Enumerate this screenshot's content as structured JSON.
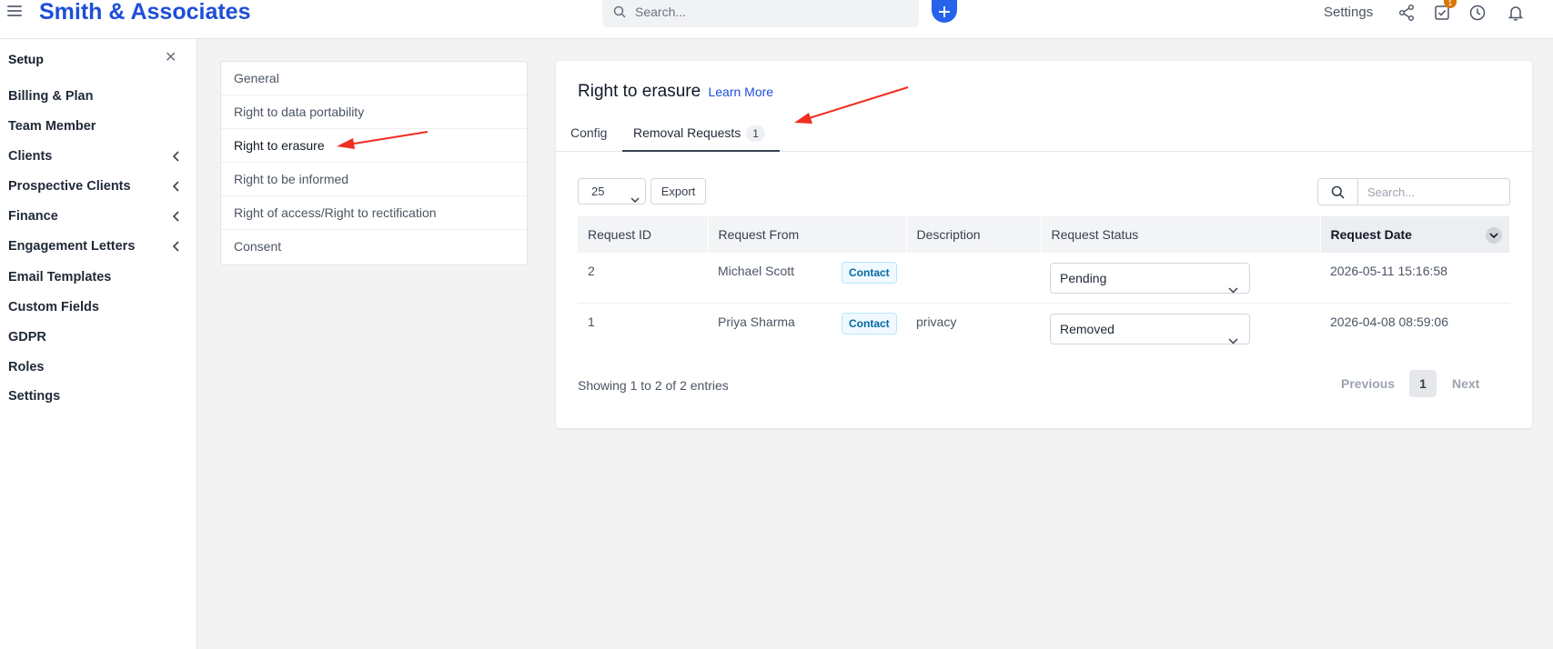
{
  "header": {
    "brand": "Smith & Associates",
    "search_placeholder": "Search...",
    "settings_label": "Settings",
    "notification_count": "1"
  },
  "sidebar": {
    "title": "Setup",
    "items": [
      {
        "label": "Billing & Plan",
        "expandable": false
      },
      {
        "label": "Team Member",
        "expandable": false
      },
      {
        "label": "Clients",
        "expandable": true
      },
      {
        "label": "Prospective Clients",
        "expandable": true
      },
      {
        "label": "Finance",
        "expandable": true
      },
      {
        "label": "Engagement Letters",
        "expandable": true
      },
      {
        "label": "Email Templates",
        "expandable": false
      },
      {
        "label": "Custom Fields",
        "expandable": false
      },
      {
        "label": "GDPR",
        "expandable": false
      },
      {
        "label": "Roles",
        "expandable": false
      },
      {
        "label": "Settings",
        "expandable": false
      }
    ]
  },
  "gdpr_nav": {
    "items": [
      "General",
      "Right to data portability",
      "Right to erasure",
      "Right to be informed",
      "Right of access/Right to rectification",
      "Consent"
    ],
    "active_index": 2
  },
  "main": {
    "title": "Right to erasure",
    "learn_more": "Learn More",
    "tabs": [
      {
        "label": "Config",
        "count": ""
      },
      {
        "label": "Removal Requests",
        "count": "1"
      }
    ],
    "active_tab": 1,
    "page_length": "25",
    "export_label": "Export",
    "table_search_placeholder": "Search...",
    "table": {
      "columns": [
        "Request ID",
        "Request From",
        "Description",
        "Request Status",
        "Request Date"
      ],
      "rows": [
        {
          "id": "2",
          "from": "Michael Scott",
          "type": "Contact",
          "description": "",
          "status": "Pending",
          "date": "2026-05-11 15:16:58"
        },
        {
          "id": "1",
          "from": "Priya Sharma",
          "type": "Contact",
          "description": "privacy",
          "status": "Removed",
          "date": "2026-04-08 08:59:06"
        }
      ]
    },
    "info": "Showing 1 to 2 of 2 entries",
    "pager": {
      "previous": "Previous",
      "current": "1",
      "next": "Next"
    }
  },
  "colors": {
    "brand": "#1d4ed8",
    "accent": "#2563eb",
    "annotation_arrow": "#ef2d21",
    "badge": "#d97706"
  }
}
